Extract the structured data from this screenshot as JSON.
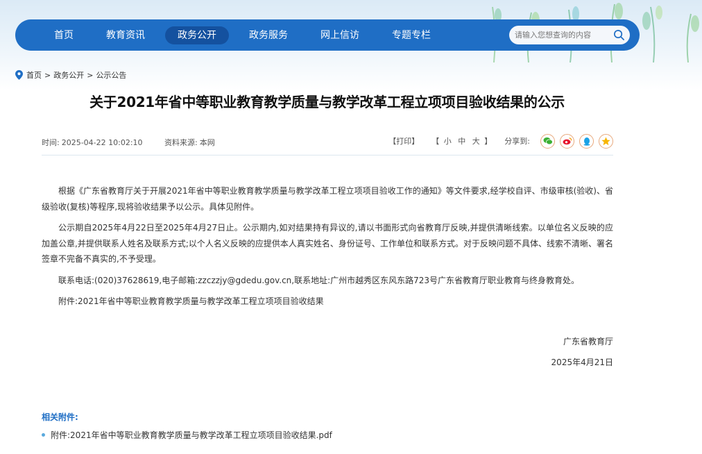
{
  "nav": {
    "items": [
      {
        "label": "首页"
      },
      {
        "label": "教育资讯"
      },
      {
        "label": "政务公开"
      },
      {
        "label": "政务服务"
      },
      {
        "label": "网上信访"
      },
      {
        "label": "专题专栏"
      }
    ],
    "active_index": 2,
    "search_placeholder": "请输入您想查询的内容"
  },
  "breadcrumb": {
    "items": [
      "首页",
      "政务公开",
      "公示公告"
    ],
    "separator": ">"
  },
  "article": {
    "title": "关于2021年省中等职业教育教学质量与教学改革工程立项项目验收结果的公示",
    "time_label": "时间:",
    "time": "2025-04-22 10:02:10",
    "source_label": "资料来源:",
    "source": "本网",
    "print_label": "【打印】",
    "size_open": "【",
    "size_small": "小",
    "size_medium": "中",
    "size_large": "大",
    "size_close": "】",
    "share_label": "分享到:",
    "paragraphs": [
      "根据《广东省教育厅关于开展2021年省中等职业教育教学质量与教学改革工程立项项目验收工作的通知》等文件要求,经学校自评、市级审核(验收)、省级验收(复核)等程序,现将验收结果予以公示。具体见附件。",
      "公示期自2025年4月22日至2025年4月27日止。公示期内,如对结果持有异议的,请以书面形式向省教育厅反映,并提供清晰线索。以单位名义反映的应加盖公章,并提供联系人姓名及联系方式;以个人名义反映的应提供本人真实姓名、身份证号、工作单位和联系方式。对于反映问题不具体、线索不清晰、署名签章不完备不真实的,不予受理。",
      "联系电话:(020)37628619,电子邮箱:zzczzjy@gdedu.gov.cn,联系地址:广州市越秀区东风东路723号广东省教育厅职业教育与终身教育处。",
      "附件:2021年省中等职业教育教学质量与教学改革工程立项项目验收结果"
    ],
    "signature_org": "广东省教育厅",
    "signature_date": "2025年4月21日"
  },
  "attachments": {
    "title": "相关附件:",
    "items": [
      {
        "label": "附件:2021年省中等职业教育教学质量与教学改革工程立项项目验收结果.pdf"
      }
    ]
  },
  "share_icons": [
    "wechat-icon",
    "weibo-icon",
    "qq-icon",
    "qzone-icon"
  ],
  "colors": {
    "nav_bg": "#1f6ec5",
    "nav_active": "#14519f",
    "accent": "#1f6ec5"
  }
}
